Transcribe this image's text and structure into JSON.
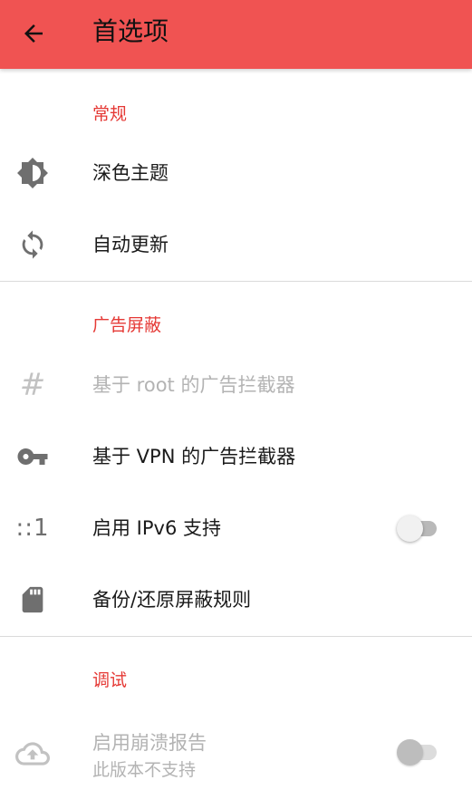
{
  "app_bar": {
    "title": "首选项",
    "back_icon": "arrow-back-icon",
    "color": "#f05352"
  },
  "sections": {
    "general": {
      "header": "常规",
      "items": {
        "dark_theme": {
          "title": "深色主题",
          "icon": "brightness-icon"
        },
        "auto_update": {
          "title": "自动更新",
          "icon": "sync-icon"
        }
      }
    },
    "ad_blocking": {
      "header": "广告屏蔽",
      "items": {
        "root_blocker": {
          "title": "基于 root 的广告拦截器",
          "icon": "hash-icon",
          "icon_glyph": "#",
          "enabled": false
        },
        "vpn_blocker": {
          "title": "基于 VPN 的广告拦截器",
          "icon": "key-icon"
        },
        "ipv6": {
          "title": "启用 IPv6 支持",
          "icon": "ipv6-icon",
          "icon_glyph": "::1",
          "switch_on": false
        },
        "backup_restore": {
          "title": "备份/还原屏蔽规则",
          "icon": "sd-card-icon"
        }
      }
    },
    "debug": {
      "header": "调试",
      "items": {
        "crash_report": {
          "title": "启用崩溃报告",
          "summary": "此版本不支持",
          "icon": "cloud-upload-icon",
          "enabled": false,
          "switch_on": false
        }
      }
    }
  },
  "colors": {
    "accent": "#e53935",
    "text_primary": "#1a1a1a",
    "text_disabled": "#b3b3b3",
    "icon": "#6f6f6f",
    "divider": "#dadada"
  }
}
